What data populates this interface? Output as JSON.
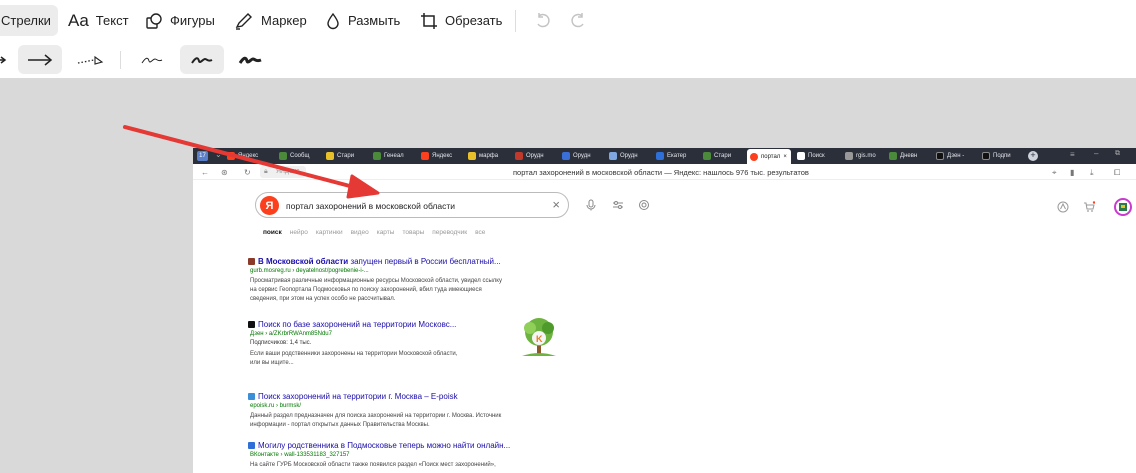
{
  "toolbar": {
    "arrows_label": "Стрелки",
    "text_label": "Текст",
    "shapes_label": "Фигуры",
    "marker_label": "Маркер",
    "blur_label": "Размыть",
    "crop_label": "Обрезать"
  },
  "arrow_colors": {
    "accent": "#e53935"
  },
  "browser": {
    "tabs": [
      "Яндекс",
      "Сообщ",
      "Стари",
      "Генеал",
      "Яндекс",
      "марфа",
      "Орудн",
      "Орудн",
      "Орудн",
      "Екатер",
      "Стари",
      "портал",
      "Поиск",
      "rgis.mo",
      "Дневн",
      "Дзен -",
      "Подпи"
    ],
    "address_host": "Яндекс",
    "page_title": "портал захоронений в московской области — Яндекс: нашлось 976 тыс. результатов"
  },
  "search": {
    "query": "портал захоронений в московской области",
    "logo_letter": "Я"
  },
  "nav_tabs": [
    {
      "label": "поиск",
      "active": true
    },
    {
      "label": "нейро",
      "active": false
    },
    {
      "label": "картинки",
      "active": false
    },
    {
      "label": "видео",
      "active": false
    },
    {
      "label": "карты",
      "active": false
    },
    {
      "label": "товары",
      "active": false
    },
    {
      "label": "переводчик",
      "active": false
    },
    {
      "label": "все",
      "active": false
    }
  ],
  "results": [
    {
      "title_bold": "В Московской области",
      "title_rest": " запущен первый в России бесплатный...",
      "url": "gurb.mosreg.ru › deyatelnost/pogrebenie-i-...",
      "meta": "",
      "snippet": [
        "Просматривая различные информационные ресурсы Московской области, увидел ссылку",
        "на сервис Геопортала Подмосковья по поиску захоронений, вбил туда имеющиеся",
        "сведения, при этом на успех особо не рассчитывал."
      ]
    },
    {
      "title_bold": "",
      "title_rest": "Поиск по базе захоронений на территории Московс...",
      "url": "Дзен › a/ZKrbrRWAnm85Ndu7",
      "meta": "Подписчиков: 1,4 тыс.",
      "snippet": [
        "Если ваши родственники захоронены на территории Московской области,",
        "или вы ищите..."
      ]
    },
    {
      "title_bold": "",
      "title_rest": "Поиск захоронений на территории г. Москва – E-poisk",
      "url": "epoisk.ru › burmsk/",
      "meta": "",
      "snippet": [
        "Данный раздел предназначен для поиска захоронений на территории г. Москва. Источник",
        "информации - портал открытых данных Правительства Москвы."
      ]
    },
    {
      "title_bold": "",
      "title_rest": "Могилу родственника в Подмосковье теперь можно найти онлайн...",
      "url": "ВКонтакте › wall-133531183_327157",
      "meta": "",
      "snippet": [
        "На сайте ГУРБ Московской области также появился раздел «Поиск мест захоронений»,"
      ]
    }
  ]
}
